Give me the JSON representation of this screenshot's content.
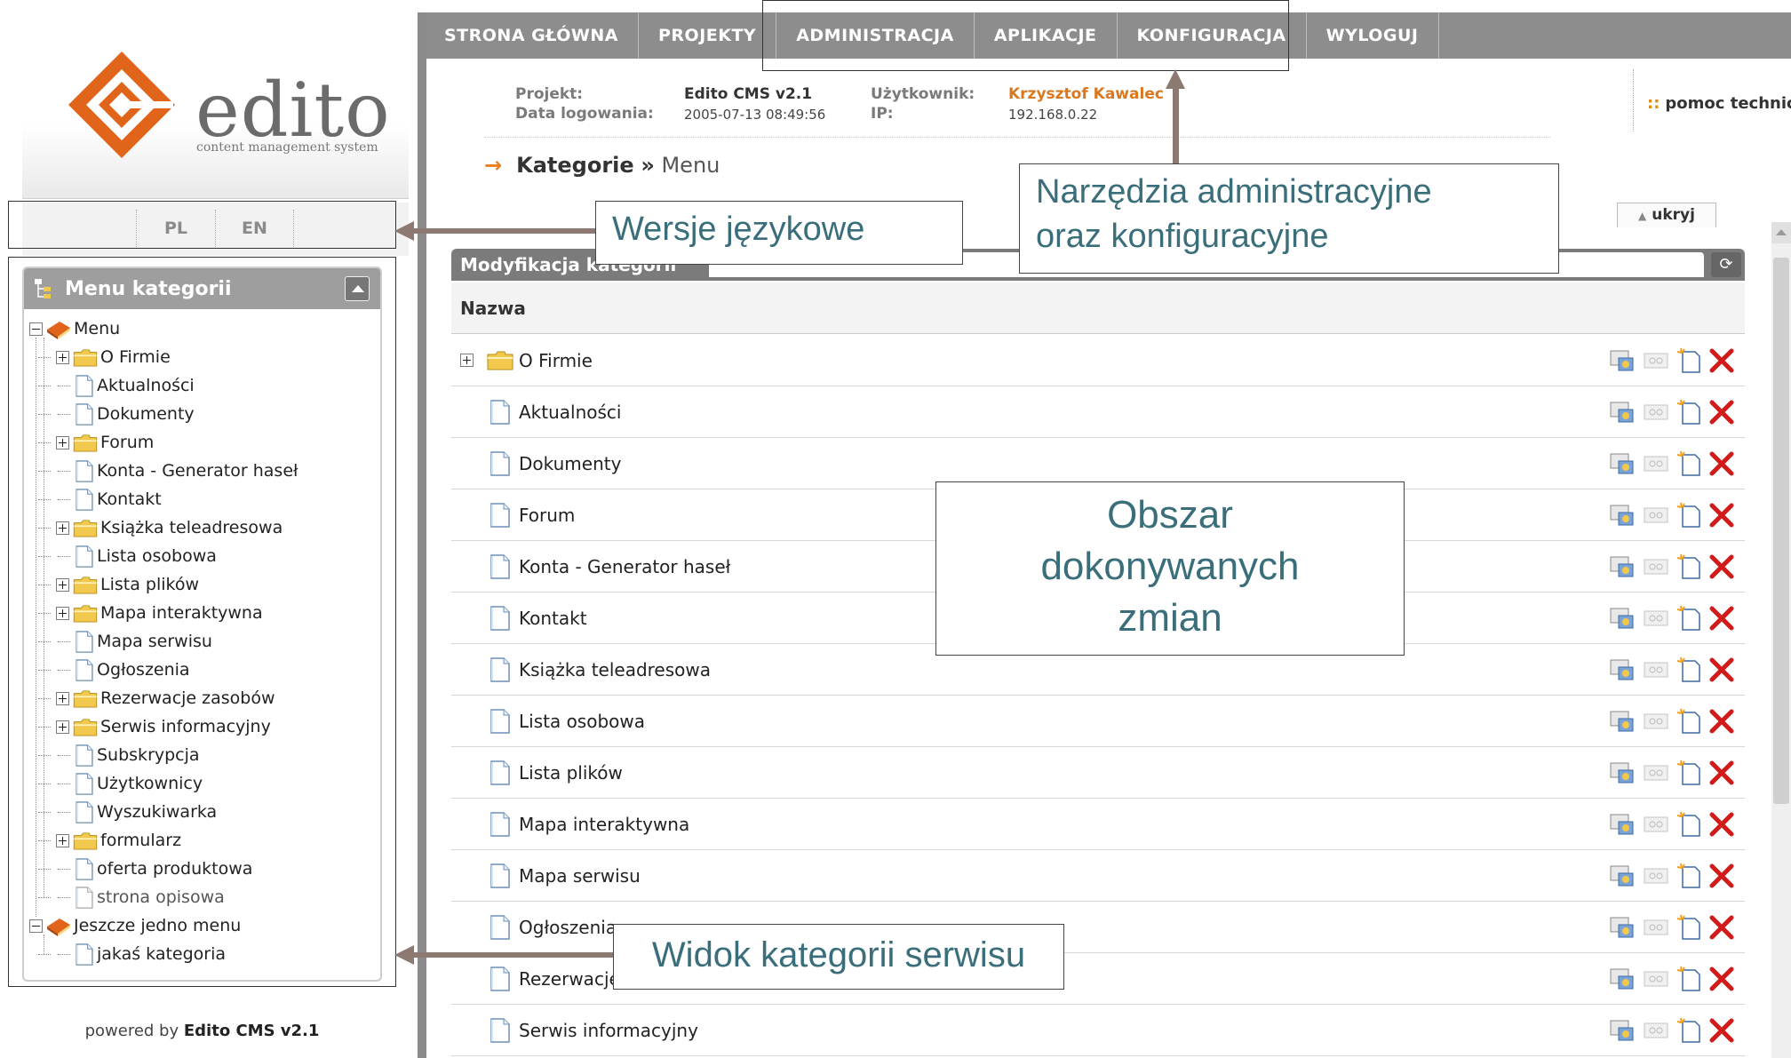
{
  "brand": {
    "logo_word": "edito",
    "tagline": "content management system",
    "powered_prefix": "powered by",
    "powered_product": "Edito CMS v2.1"
  },
  "languages": [
    "PL",
    "EN"
  ],
  "category_menu": {
    "title": "Menu kategorii",
    "items": [
      {
        "label": "Menu",
        "type": "book",
        "level": 0,
        "expand": "minus"
      },
      {
        "label": "O Firmie",
        "type": "folder",
        "level": 1,
        "expand": "plus"
      },
      {
        "label": "Aktualności",
        "type": "page",
        "level": 1
      },
      {
        "label": "Dokumenty",
        "type": "page",
        "level": 1
      },
      {
        "label": "Forum",
        "type": "folder",
        "level": 1,
        "expand": "plus"
      },
      {
        "label": "Konta - Generator haseł",
        "type": "page",
        "level": 1
      },
      {
        "label": "Kontakt",
        "type": "page",
        "level": 1
      },
      {
        "label": "Książka teleadresowa",
        "type": "folder",
        "level": 1,
        "expand": "plus"
      },
      {
        "label": "Lista osobowa",
        "type": "page",
        "level": 1
      },
      {
        "label": "Lista plików",
        "type": "folder",
        "level": 1,
        "expand": "plus"
      },
      {
        "label": "Mapa interaktywna",
        "type": "folder",
        "level": 1,
        "expand": "plus"
      },
      {
        "label": "Mapa serwisu",
        "type": "page",
        "level": 1
      },
      {
        "label": "Ogłoszenia",
        "type": "page",
        "level": 1
      },
      {
        "label": "Rezerwacje zasobów",
        "type": "folder",
        "level": 1,
        "expand": "plus"
      },
      {
        "label": "Serwis informacyjny",
        "type": "folder",
        "level": 1,
        "expand": "plus"
      },
      {
        "label": "Subskrypcja",
        "type": "page",
        "level": 1
      },
      {
        "label": "Użytkownicy",
        "type": "page",
        "level": 1
      },
      {
        "label": "Wyszukiwarka",
        "type": "page",
        "level": 1
      },
      {
        "label": "formularz",
        "type": "folder",
        "level": 1,
        "expand": "plus"
      },
      {
        "label": "oferta produktowa",
        "type": "page",
        "level": 1
      },
      {
        "label": "strona opisowa",
        "type": "page",
        "level": 1,
        "dim": true
      },
      {
        "label": "Jeszcze jedno menu",
        "type": "book",
        "level": 0,
        "expand": "minus"
      },
      {
        "label": "jakaś kategoria",
        "type": "page",
        "level": 1
      }
    ]
  },
  "top_nav": [
    "STRONA GŁÓWNA",
    "PROJEKTY",
    "ADMINISTRACJA",
    "APLIKACJE",
    "KONFIGURACJA",
    "WYLOGUJ"
  ],
  "info": {
    "project_label": "Projekt:",
    "project_value": "Edito CMS v2.1",
    "login_date_label": "Data logowania:",
    "login_date_value": "2005-07-13 08:49:56",
    "user_label": "Użytkownik:",
    "user_value": "Krzysztof Kawalec",
    "ip_label": "IP:",
    "ip_value": "192.168.0.22",
    "help_bullet": "::",
    "help": "pomoc techniczna"
  },
  "breadcrumb": {
    "arrow": "→",
    "section": "Kategorie",
    "separator": "»",
    "current": "Menu"
  },
  "panel": {
    "hide_label": "ukryj",
    "title": "Modyfikacja kategorii",
    "column_name": "Nazwa",
    "rows": [
      {
        "label": "O Firmie",
        "type": "folder"
      },
      {
        "label": "Aktualności",
        "type": "page"
      },
      {
        "label": "Dokumenty",
        "type": "page"
      },
      {
        "label": "Forum",
        "type": "page"
      },
      {
        "label": "Konta - Generator haseł",
        "type": "page"
      },
      {
        "label": "Kontakt",
        "type": "page"
      },
      {
        "label": "Książka teleadresowa",
        "type": "page"
      },
      {
        "label": "Lista osobowa",
        "type": "page"
      },
      {
        "label": "Lista plików",
        "type": "page"
      },
      {
        "label": "Mapa interaktywna",
        "type": "page"
      },
      {
        "label": "Mapa serwisu",
        "type": "page"
      },
      {
        "label": "Ogłoszenia",
        "type": "page"
      },
      {
        "label": "Rezerwacje zasobów",
        "type": "page"
      },
      {
        "label": "Serwis informacyjny",
        "type": "page"
      }
    ]
  },
  "annotations": {
    "language_versions": "Wersje językowe",
    "admin_tools_line1": "Narzędzia administracyjne",
    "admin_tools_line2": "oraz konfiguracyjne",
    "change_area_line1": "Obszar",
    "change_area_line2": "dokonywanych",
    "change_area_line3": "zmian",
    "category_view": "Widok kategorii serwisu"
  },
  "colors": {
    "orange_accent": "#e8801c",
    "nav_gray": "#8d8d8d",
    "annotation_text": "#3a6e7a",
    "delete_red": "#d21a1a"
  }
}
